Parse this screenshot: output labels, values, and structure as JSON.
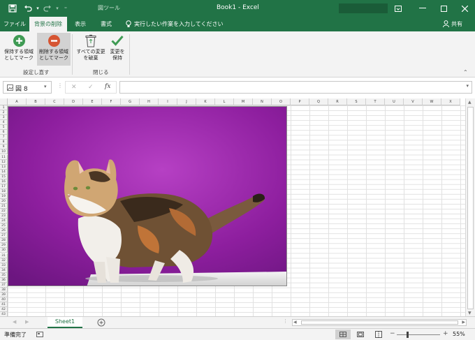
{
  "titlebar": {
    "contextual_tab_group": "図ツール",
    "title": "Book1 - Excel",
    "save_icon": "save-icon",
    "undo_icon": "undo-icon",
    "redo_icon": "redo-icon"
  },
  "tabs": {
    "file": "ファイル",
    "remove_background": "背景の削除",
    "view": "表示",
    "format": "書式",
    "tell_me": "実行したい作業を入力してください",
    "share": "共有"
  },
  "ribbon": {
    "mark_keep_l1": "保持する領域",
    "mark_keep_l2": "としてマーク",
    "mark_remove_l1": "削除する領域",
    "mark_remove_l2": "としてマーク",
    "discard_l1": "すべての変更",
    "discard_l2": "を破棄",
    "keep_l1": "変更を",
    "keep_l2": "保持",
    "group_refine": "設定し直す",
    "group_close": "閉じる"
  },
  "formula_bar": {
    "name_box": "図 8",
    "fx": "fx",
    "formula": ""
  },
  "columns": [
    "A",
    "B",
    "C",
    "D",
    "E",
    "F",
    "G",
    "H",
    "I",
    "J",
    "K",
    "L",
    "M",
    "N",
    "O",
    "P",
    "Q",
    "R",
    "S",
    "T",
    "U",
    "V",
    "W",
    "X"
  ],
  "rows": [
    "1",
    "2",
    "3",
    "4",
    "5",
    "6",
    "7",
    "8",
    "9",
    "10",
    "11",
    "12",
    "13",
    "14",
    "15",
    "16",
    "17",
    "18",
    "19",
    "20",
    "21",
    "22",
    "23",
    "24",
    "25",
    "26",
    "27",
    "28",
    "29",
    "30",
    "31",
    "32",
    "33",
    "34",
    "35",
    "36",
    "37",
    "38",
    "39",
    "40",
    "41",
    "42",
    "43"
  ],
  "sheet": {
    "tab": "Sheet1",
    "add_icon": "plus-circle-icon"
  },
  "status": {
    "ready": "準備完了",
    "zoom": "55%"
  },
  "colors": {
    "brand": "#217346",
    "purple_bg": "#8a1a9a"
  }
}
